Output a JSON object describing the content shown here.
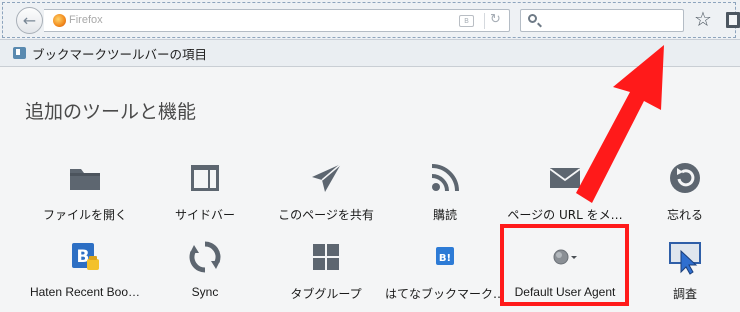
{
  "navbar": {
    "back_glyph": "←",
    "url_placeholder": "Firefox",
    "reader_glyph": "B",
    "reload_glyph": "↻",
    "search_placeholder": "",
    "star_glyph": "☆"
  },
  "bookmarks_toolbar": {
    "label": "ブックマークツールバーの項目"
  },
  "palette": {
    "title": "追加のツールと機能",
    "items": [
      {
        "label": "ファイルを開く",
        "icon": "folder-icon"
      },
      {
        "label": "サイドバー",
        "icon": "sidebar-icon"
      },
      {
        "label": "このページを共有",
        "icon": "share-icon"
      },
      {
        "label": "購読",
        "icon": "feed-icon"
      },
      {
        "label": "ページの URL をメ…",
        "icon": "email-link-icon"
      },
      {
        "label": "忘れる",
        "icon": "forget-icon"
      },
      {
        "label": "Haten Recent Boo…",
        "icon": "hatena-recent-icon"
      },
      {
        "label": "Sync",
        "icon": "sync-icon"
      },
      {
        "label": "タブグループ",
        "icon": "tab-groups-icon"
      },
      {
        "label": "はてなブックマーク…",
        "icon": "hatena-bookmark-icon"
      },
      {
        "label": "Default User Agent",
        "icon": "user-agent-icon"
      },
      {
        "label": "調査",
        "icon": "inspect-icon"
      }
    ]
  },
  "colors": {
    "highlight": "#ff1a1a",
    "icon_gray": "#5d6670",
    "hatena_blue": "#2d7bd6"
  }
}
